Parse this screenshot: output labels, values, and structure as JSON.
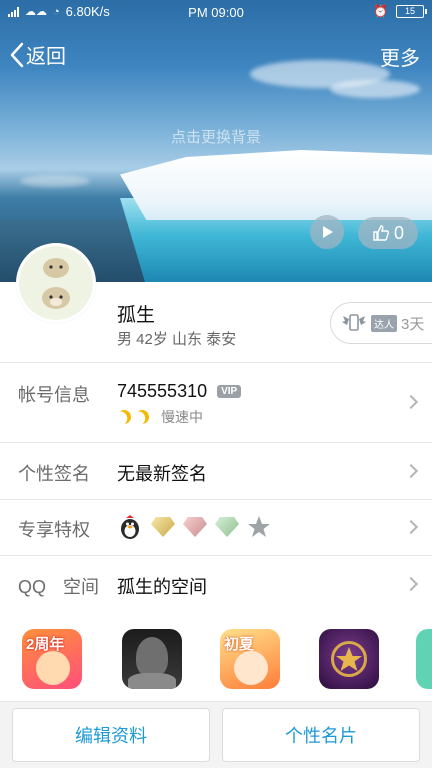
{
  "status_bar": {
    "network_speed": "6.80K/s",
    "time": "PM 09:00",
    "battery": "15"
  },
  "nav": {
    "back_label": "返回",
    "more_label": "更多"
  },
  "cover": {
    "change_background_hint": "点击更换背景",
    "like_count": "0"
  },
  "profile": {
    "nickname": "孤生",
    "details": "男 42岁 山东 泰安",
    "talent_badge": "达人",
    "talent_days": "3天"
  },
  "rows": {
    "account": {
      "label": "帐号信息",
      "qq_number": "745555310",
      "vip_badge": "VIP",
      "speed_status": "慢速中"
    },
    "signature": {
      "label": "个性签名",
      "value": "无最新签名"
    },
    "privileges": {
      "label": "专享特权"
    },
    "qzone": {
      "label_left": "QQ",
      "label_right": "空间",
      "value": "孤生的空间"
    }
  },
  "games": {
    "items": [
      {
        "icon": "game-icon-2-anniversary",
        "overlay": "2周年"
      },
      {
        "icon": "game-icon-portrait"
      },
      {
        "icon": "game-icon-chibi",
        "overlay": "初夏"
      },
      {
        "icon": "game-icon-star-badge"
      }
    ]
  },
  "buttons": {
    "edit_profile": "编辑资料",
    "personal_card": "个性名片"
  },
  "colors": {
    "accent": "#1e9ad6",
    "label_gray": "#6b6b6b"
  }
}
